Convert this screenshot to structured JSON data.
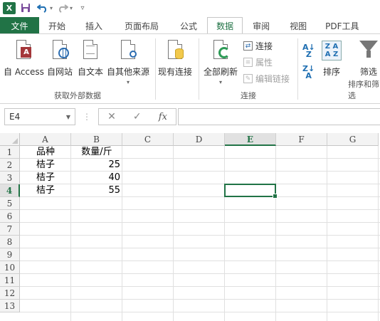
{
  "app": {
    "logo_text": "X"
  },
  "qat": {
    "save_icon": "save-icon",
    "undo_icon": "undo-icon",
    "redo_icon": "redo-icon",
    "customize_icon": "customize-icon"
  },
  "tabs": [
    {
      "label": "文件",
      "kind": "file"
    },
    {
      "label": "开始"
    },
    {
      "label": "插入"
    },
    {
      "label": "页面布局"
    },
    {
      "label": "公式"
    },
    {
      "label": "数据",
      "active": true
    },
    {
      "label": "审阅"
    },
    {
      "label": "视图"
    },
    {
      "label": "PDF工具"
    }
  ],
  "ribbon": {
    "get_external": {
      "label": "获取外部数据",
      "from_access": "自 Access",
      "from_web": "自网站",
      "from_text": "自文本",
      "from_other": "自其他来源"
    },
    "existing_connections": "现有连接",
    "connections": {
      "label": "连接",
      "refresh_all": "全部刷新",
      "connections": "连接",
      "properties": "属性",
      "edit_links": "编辑链接"
    },
    "sort_filter": {
      "label": "排序和筛选",
      "sort": "排序",
      "filter": "筛选"
    }
  },
  "formula_bar": {
    "name_box": "E4",
    "fx": "fx",
    "value": ""
  },
  "colors": {
    "accent": "#217346",
    "file_tab": "#217346"
  },
  "grid": {
    "columns": [
      "A",
      "B",
      "C",
      "D",
      "E",
      "F",
      "G"
    ],
    "rows": [
      "1",
      "2",
      "3",
      "4",
      "5",
      "6",
      "7",
      "8",
      "9",
      "10",
      "11",
      "12",
      "13"
    ],
    "selected_cell": "E4",
    "cells": [
      {
        "ref": "A1",
        "value": "品种",
        "type": "text"
      },
      {
        "ref": "B1",
        "value": "数量/斤",
        "type": "text"
      },
      {
        "ref": "A2",
        "value": "桔子",
        "type": "text"
      },
      {
        "ref": "B2",
        "value": "25",
        "type": "num"
      },
      {
        "ref": "A3",
        "value": "桔子",
        "type": "text"
      },
      {
        "ref": "B3",
        "value": "40",
        "type": "num"
      },
      {
        "ref": "A4",
        "value": "桔子",
        "type": "text"
      },
      {
        "ref": "B4",
        "value": "55",
        "type": "num"
      }
    ]
  }
}
